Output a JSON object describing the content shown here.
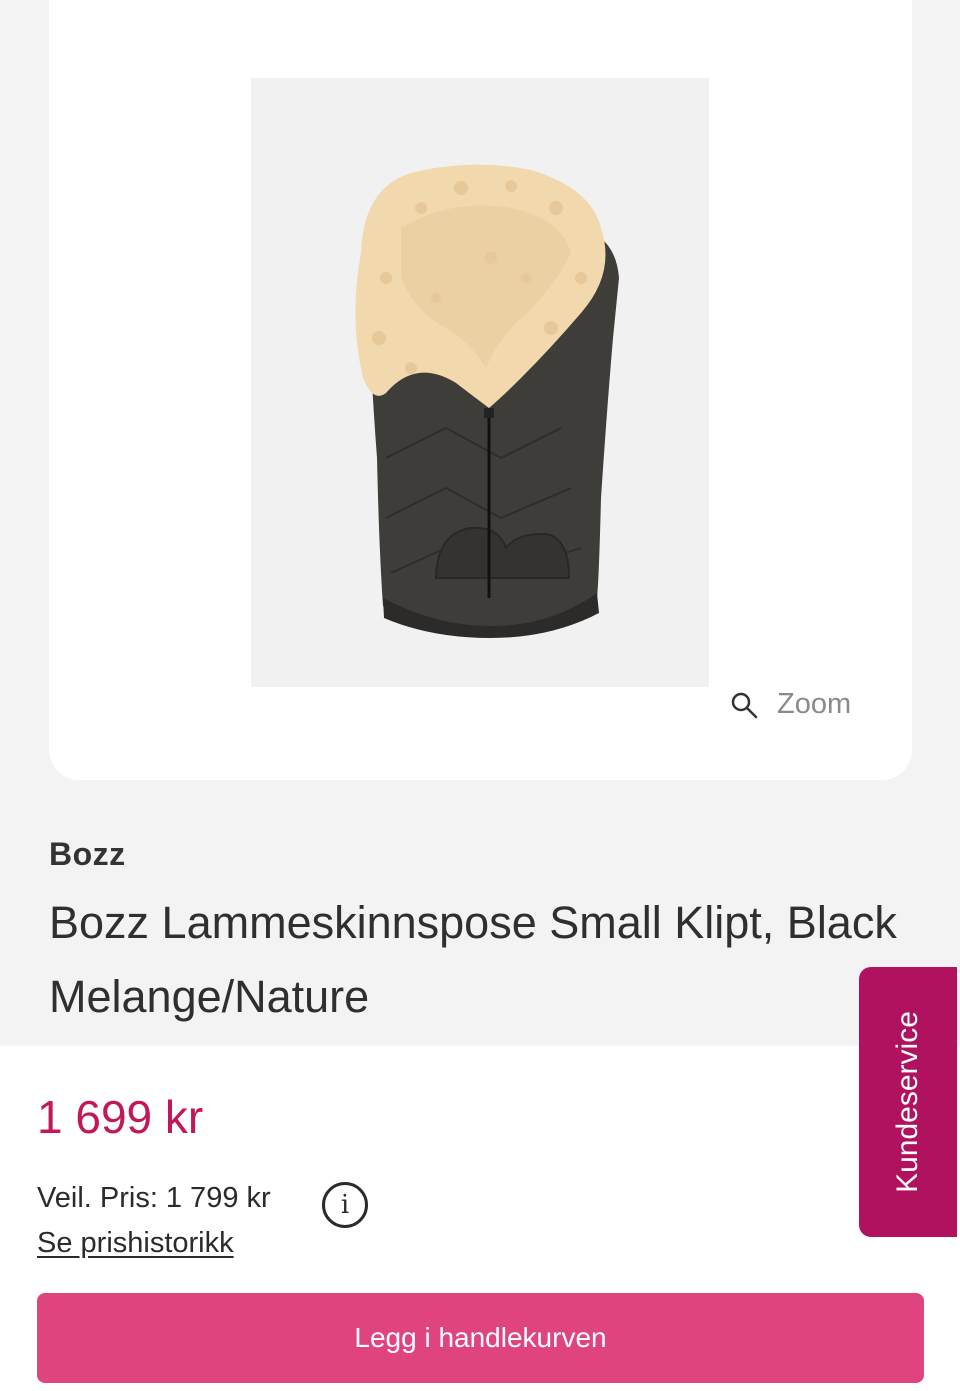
{
  "product": {
    "image_alt": "Bozz Lammeskinnspose Small Klipt, Black Melange/Nature",
    "zoom_label": "Zoom",
    "brand": "Bozz",
    "title": "Bozz Lammeskinnspose Small Klipt, Black Melange/Nature"
  },
  "pricing": {
    "price": "1 699 kr",
    "rrp_label": "Veil. Pris:",
    "rrp_value": "1 799 kr",
    "info_glyph": "i",
    "history_link": "Se prishistorikk"
  },
  "actions": {
    "add_to_cart": "Legg i handlekurven"
  },
  "side_tab": {
    "label": "Kundeservice"
  },
  "colors": {
    "price": "#c2185b",
    "button": "#e0447f",
    "side_tab": "#b0125f",
    "background": "#f3f3f3"
  },
  "icons": [
    "search-icon",
    "info-icon"
  ]
}
